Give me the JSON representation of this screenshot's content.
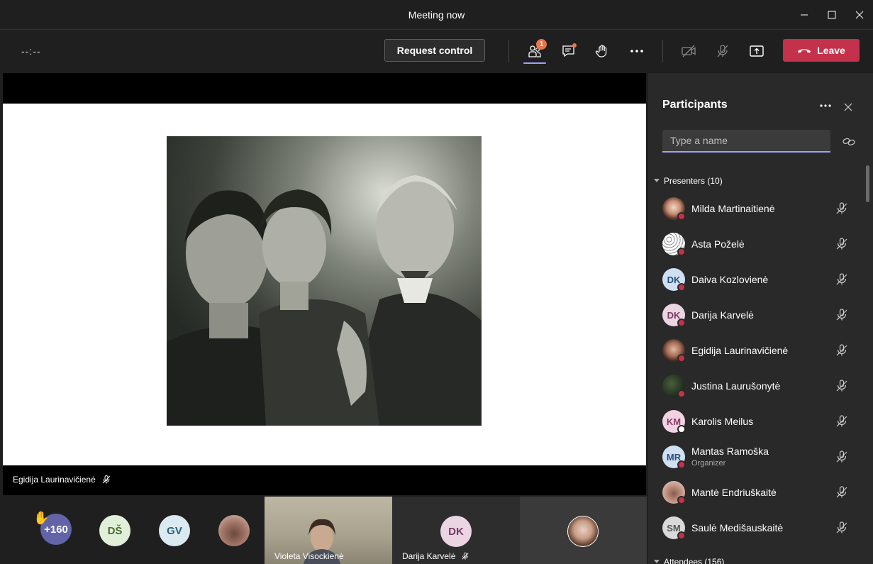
{
  "window": {
    "title": "Meeting now"
  },
  "toolbar": {
    "timer": "--:--",
    "request_control": "Request control",
    "participants_badge": "1",
    "leave": "Leave"
  },
  "stage": {
    "presenter_name": "Egidija Laurinavičienė"
  },
  "strip": {
    "overflow_count": "+160",
    "avatars": [
      {
        "initials": "DŠ"
      },
      {
        "initials": "GV"
      }
    ],
    "tiles": [
      {
        "name": "Violeta Visockienė"
      },
      {
        "name": "Darija Karvelė",
        "initials": "DK"
      }
    ]
  },
  "panel": {
    "title": "Participants",
    "search_placeholder": "Type a name",
    "presenters_header": "Presenters (10)",
    "attendees_header": "Attendees (156)",
    "presenters": [
      {
        "name": "Milda Martinaitienė",
        "initials": ""
      },
      {
        "name": "Asta Poželė",
        "initials": ""
      },
      {
        "name": "Daiva Kozlovienė",
        "initials": "DK"
      },
      {
        "name": "Darija Karvelė",
        "initials": "DK"
      },
      {
        "name": "Egidija Laurinavičienė",
        "initials": ""
      },
      {
        "name": "Justina Laurušonytė",
        "initials": ""
      },
      {
        "name": "Karolis Meilus",
        "initials": "KM"
      },
      {
        "name": "Mantas Ramoška",
        "initials": "MR",
        "role": "Organizer"
      },
      {
        "name": "Mantė Endriuškaitė",
        "initials": ""
      },
      {
        "name": "Saulė Medišauskaitė",
        "initials": "SM"
      }
    ]
  },
  "colors": {
    "accent": "#9ea2ff",
    "leave": "#c4314b",
    "badge": "#e97548",
    "busy": "#c4314b"
  }
}
